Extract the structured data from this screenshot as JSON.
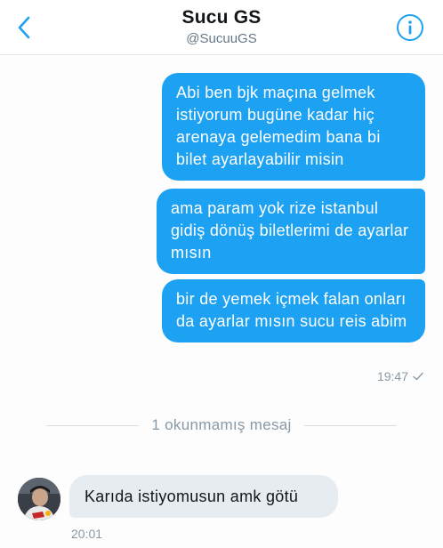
{
  "header": {
    "title": "Sucu GS",
    "handle": "@SucuuGS",
    "back_icon": "chevron-left-icon",
    "info_icon": "info-icon",
    "accent_color": "#1da1f2"
  },
  "messages_out": [
    {
      "text": "Abi ben bjk maçına gelmek istiyorum bugüne kadar hiç arenaya gelemedim bana bi bilet ayarlayabilir misin"
    },
    {
      "text": "ama param yok rize istanbul gidiş dönüş biletlerimi de ayarlar mısın"
    },
    {
      "text": "bir de yemek içmek falan onları da ayarlar mısın sucu reis abim"
    }
  ],
  "out_time": "19:47",
  "unread_divider": "1 okunmamış mesaj",
  "message_in": {
    "text": "Karıda istiyomusun amk götü",
    "time": "20:01"
  }
}
